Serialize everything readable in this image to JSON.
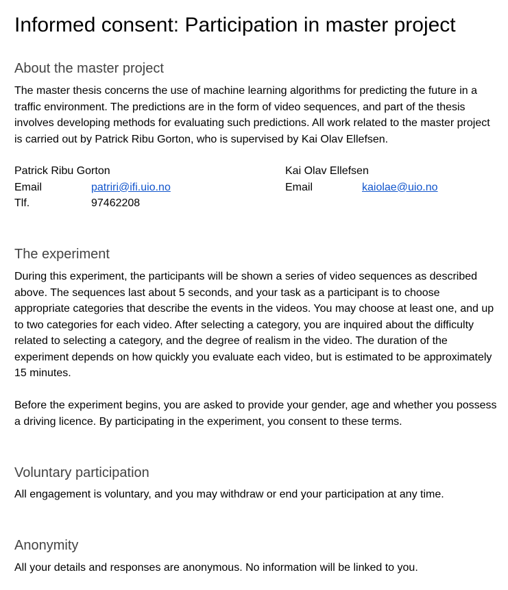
{
  "title": "Informed consent: Participation in master project",
  "sections": {
    "about": {
      "heading": "About the master project",
      "text": "The master thesis concerns the use of machine learning algorithms for predicting the future in a traffic environment. The predictions are in the form of video sequences, and part of the thesis involves developing methods for evaluating such predictions. All work related to the master project is carried out by Patrick Ribu Gorton, who is supervised by Kai Olav Ellefsen."
    },
    "experiment": {
      "heading": "The experiment",
      "text1": "During this experiment, the participants will be shown a series of video sequences as described above. The sequences last about 5 seconds, and your task as a participant is to choose appropriate categories that describe the events in the videos. You may choose at least one, and up to two categories for each video. After selecting a category, you are inquired about the difficulty related to selecting a category, and the degree of realism in the video. The duration of the experiment depends on how quickly you evaluate each video, but is estimated to be approximately 15 minutes.",
      "text2": "Before the experiment begins, you are asked to provide your gender, age and whether you possess a driving licence. By participating in the experiment, you consent to these terms."
    },
    "voluntary": {
      "heading": "Voluntary participation",
      "text": "All engagement is voluntary, and you may withdraw or end your participation at any time."
    },
    "anonymity": {
      "heading": "Anonymity",
      "text": "All your details and responses are anonymous. No information will be linked to you."
    }
  },
  "contacts": {
    "student": {
      "name": "Patrick Ribu Gorton",
      "email_label": "Email",
      "email": "patriri@ifi.uio.no",
      "phone_label": "Tlf.",
      "phone": "97462208"
    },
    "supervisor": {
      "name": "Kai Olav Ellefsen",
      "email_label": "Email",
      "email": "kaiolae@uio.no"
    }
  },
  "colors": {
    "link": "#1155cc",
    "heading": "#434343",
    "text": "#000000"
  }
}
